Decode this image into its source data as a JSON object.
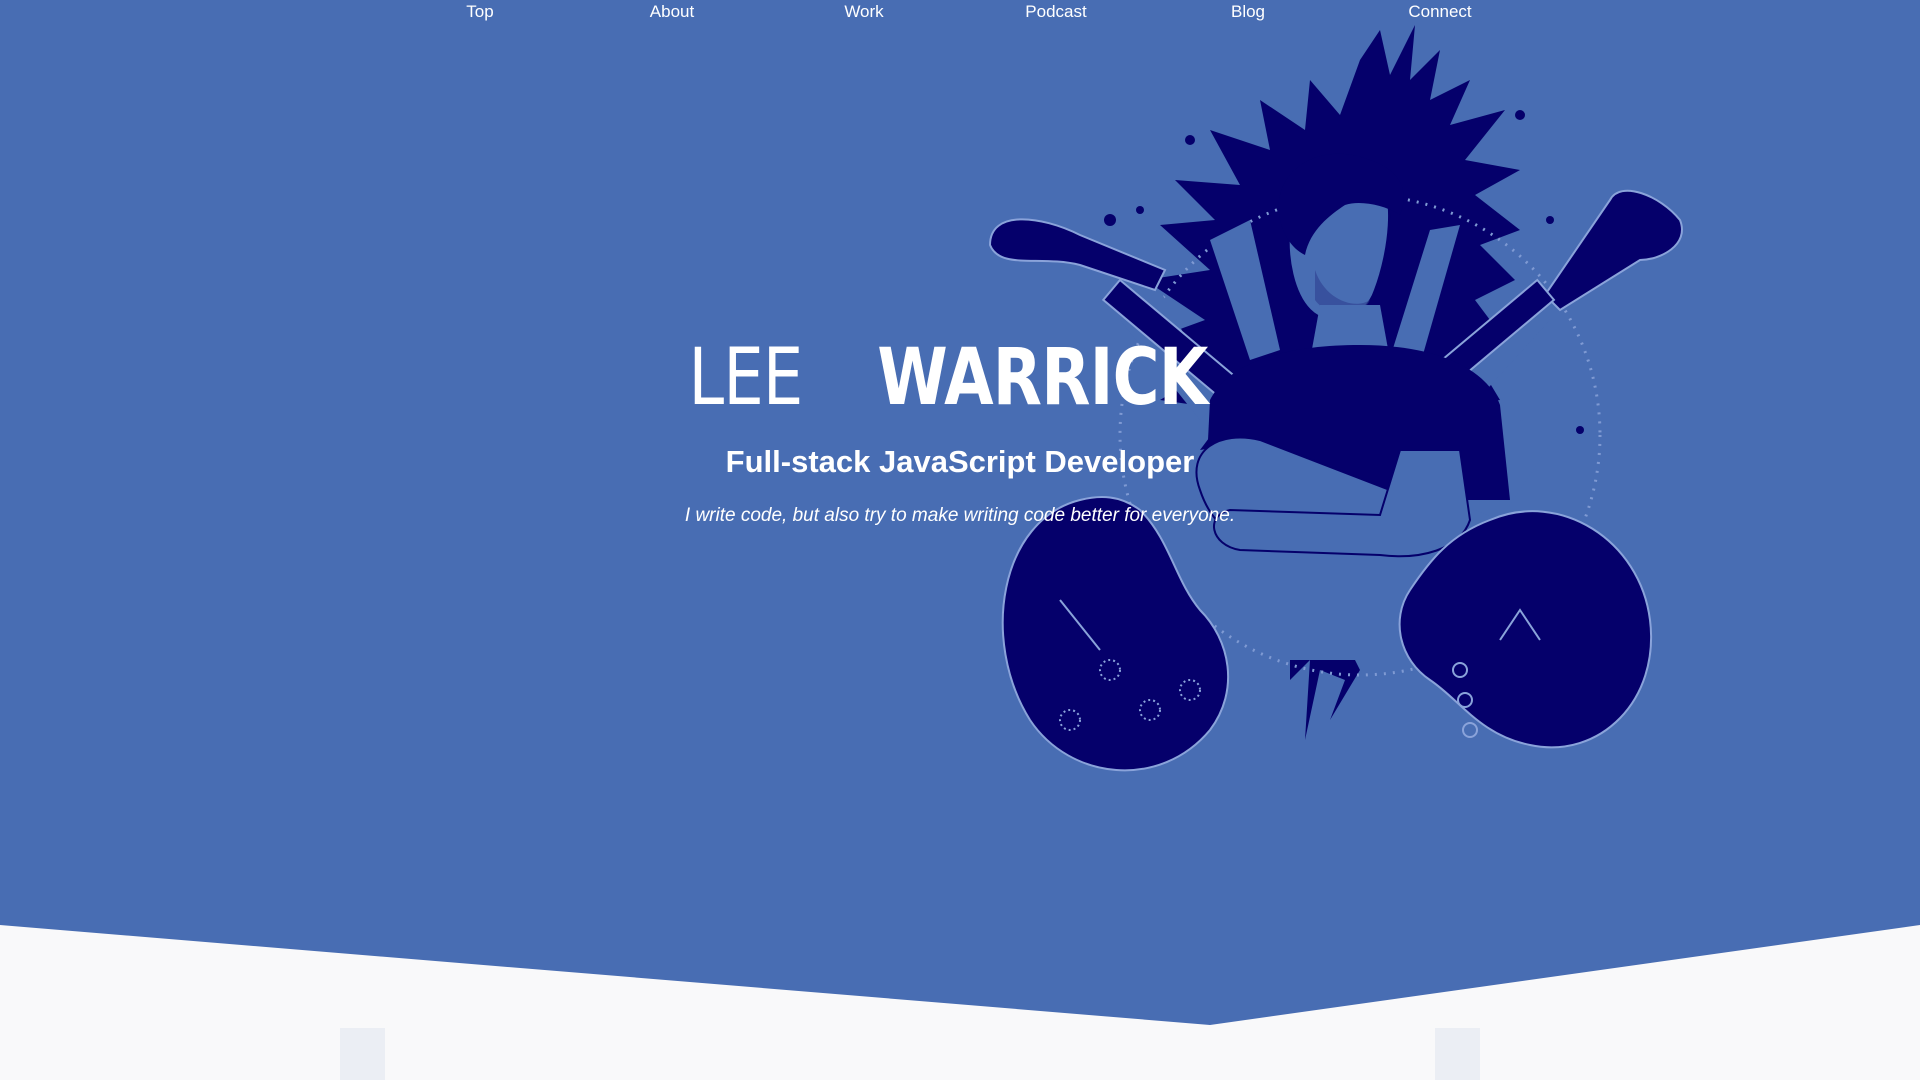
{
  "nav": {
    "items": [
      {
        "label": "Top"
      },
      {
        "label": "About"
      },
      {
        "label": "Work"
      },
      {
        "label": "Podcast"
      },
      {
        "label": "Blog"
      },
      {
        "label": "Connect"
      }
    ]
  },
  "hero": {
    "name_first": "LEE",
    "name_last": "WARRICK",
    "subtitle": "Full-stack JavaScript Developer",
    "tagline": "I write code, but also try to make writing code better for everyone."
  },
  "colors": {
    "hero_bg": "#486db3",
    "illustration_ink": "#05006b",
    "page_bg": "#f9f9fa",
    "text": "#ffffff"
  },
  "icons": {
    "hero_illustration": "guitarist-illustration"
  }
}
